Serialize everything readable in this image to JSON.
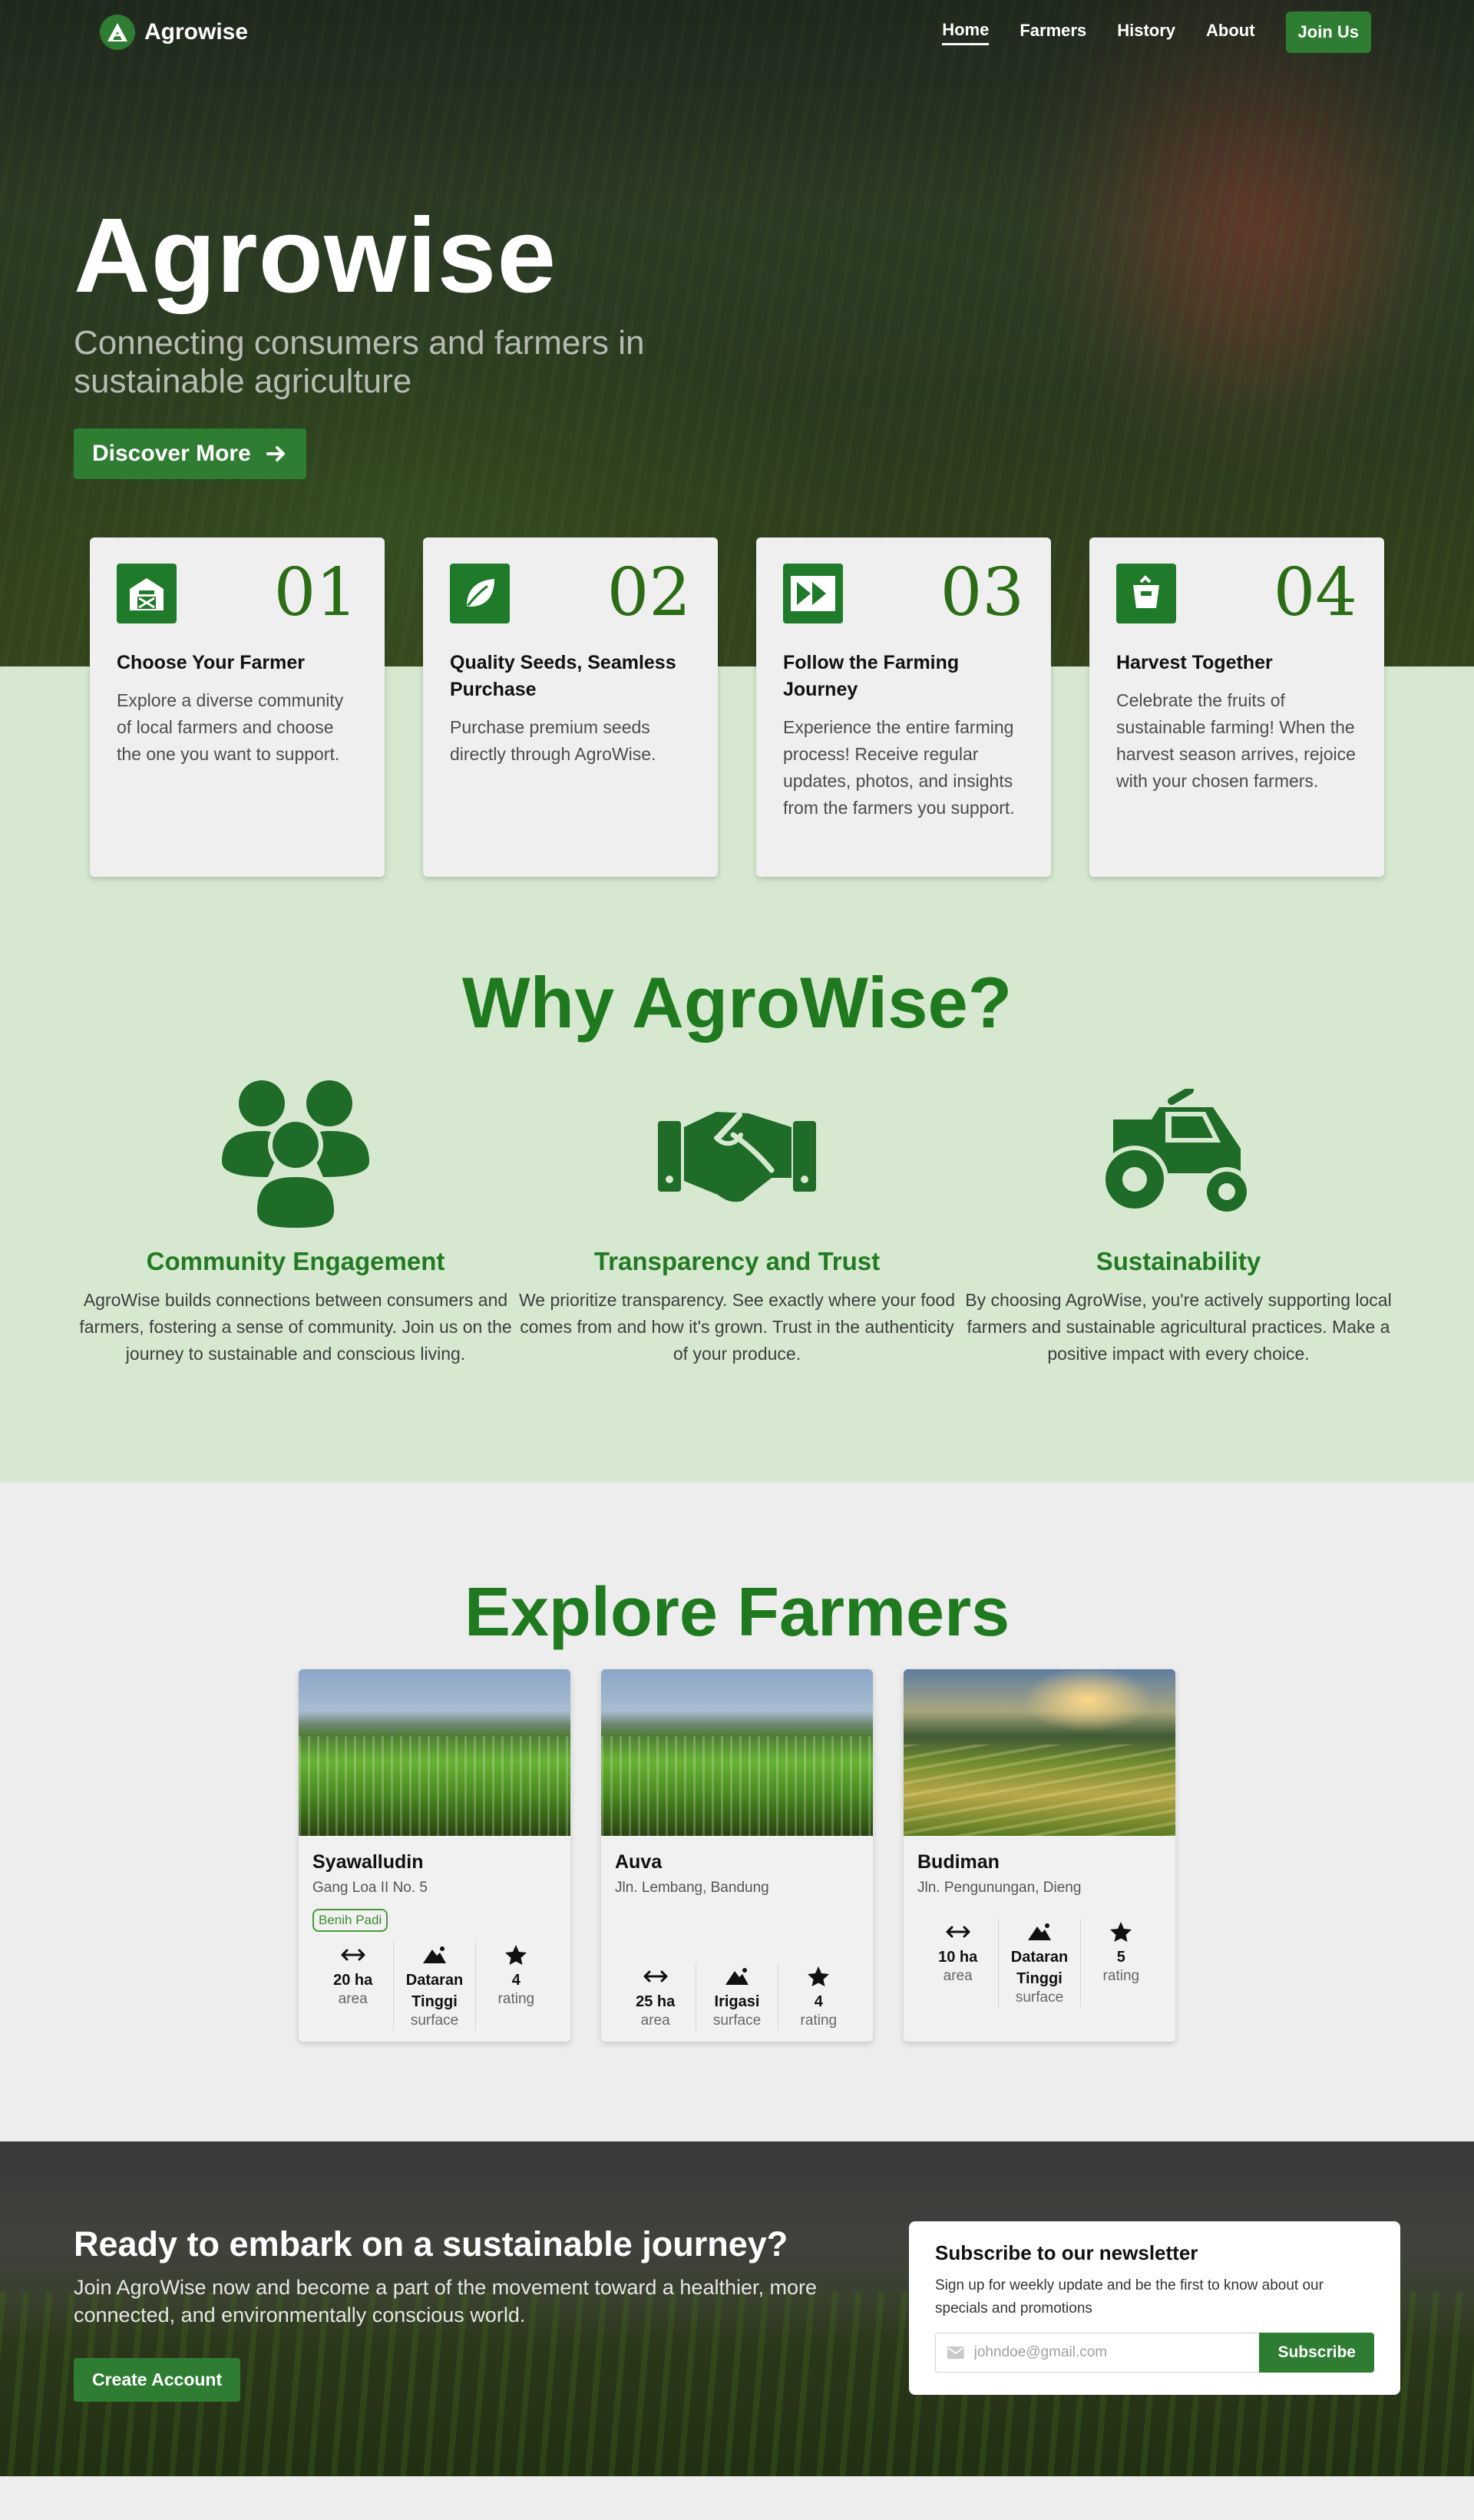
{
  "nav": {
    "brand": "Agrowise",
    "links": [
      {
        "label": "Home",
        "active": true
      },
      {
        "label": "Farmers",
        "active": false
      },
      {
        "label": "History",
        "active": false
      },
      {
        "label": "About",
        "active": false
      }
    ],
    "join_label": "Join Us"
  },
  "hero": {
    "title": "Agrowise",
    "subtitle": "Connecting consumers and farmers in sustainable agriculture",
    "cta_label": "Discover More"
  },
  "steps": [
    {
      "number": "01",
      "icon": "barn-icon",
      "title": "Choose Your Farmer",
      "desc": "Explore a diverse community of local farmers and choose the one you want to support."
    },
    {
      "number": "02",
      "icon": "leaf-icon",
      "title": "Quality Seeds, Seamless Purchase",
      "desc": "Purchase premium seeds directly through AgroWise."
    },
    {
      "number": "03",
      "icon": "fast-forward-icon",
      "title": "Follow the Farming Journey",
      "desc": "Experience the entire farming process! Receive regular updates, photos, and insights from the farmers you support."
    },
    {
      "number": "04",
      "icon": "harvest-bag-icon",
      "title": "Harvest Together",
      "desc": "Celebrate the fruits of sustainable farming! When the harvest season arrives, rejoice with your chosen farmers."
    }
  ],
  "why": {
    "title": "Why AgroWise?",
    "items": [
      {
        "icon": "community-icon",
        "title": "Community Engagement",
        "desc": "AgroWise builds connections between consumers and farmers, fostering a sense of community. Join us on the journey to sustainable and conscious living."
      },
      {
        "icon": "handshake-icon",
        "title": "Transparency and Trust",
        "desc": "We prioritize transparency. See exactly where your food comes from and how it's grown. Trust in the authenticity of your produce."
      },
      {
        "icon": "tractor-icon",
        "title": "Sustainability",
        "desc": "By choosing AgroWise, you're actively supporting local farmers and sustainable agricultural practices. Make a positive impact with every choice."
      }
    ]
  },
  "farmers": {
    "title": "Explore Farmers",
    "cards": [
      {
        "name": "Syawalludin",
        "address": "Gang Loa II No. 5",
        "badge": "Benih Padi",
        "image": "rice-field",
        "area": "20 ha",
        "area_label": "area",
        "surface": "Dataran Tinggi",
        "surface_label": "surface",
        "rating": "4",
        "rating_label": "rating"
      },
      {
        "name": "Auva",
        "address": "Jln. Lembang, Bandung",
        "badge": "",
        "image": "rice-field",
        "area": "25 ha",
        "area_label": "area",
        "surface": "Irigasi",
        "surface_label": "surface",
        "rating": "4",
        "rating_label": "rating"
      },
      {
        "name": "Budiman",
        "address": "Jln. Pengunungan, Dieng",
        "badge": "",
        "image": "rice-terrace",
        "area": "10 ha",
        "area_label": "area",
        "surface": "Dataran Tinggi",
        "surface_label": "surface",
        "rating": "5",
        "rating_label": "rating"
      }
    ]
  },
  "cta": {
    "title": "Ready to embark on a sustainable journey?",
    "desc": "Join AgroWise now and become a part of the movement toward a healthier, more connected, and environmentally conscious world.",
    "button": "Create Account"
  },
  "newsletter": {
    "title": "Subscribe to our newsletter",
    "desc": "Sign up for weekly update and be the first to know about our specials and promotions",
    "placeholder": "johndoe@gmail.com",
    "button": "Subscribe"
  },
  "colors": {
    "brand_green": "#2e7d32",
    "heading_green": "#1f7a1f",
    "band_green": "#d6e9d0"
  }
}
